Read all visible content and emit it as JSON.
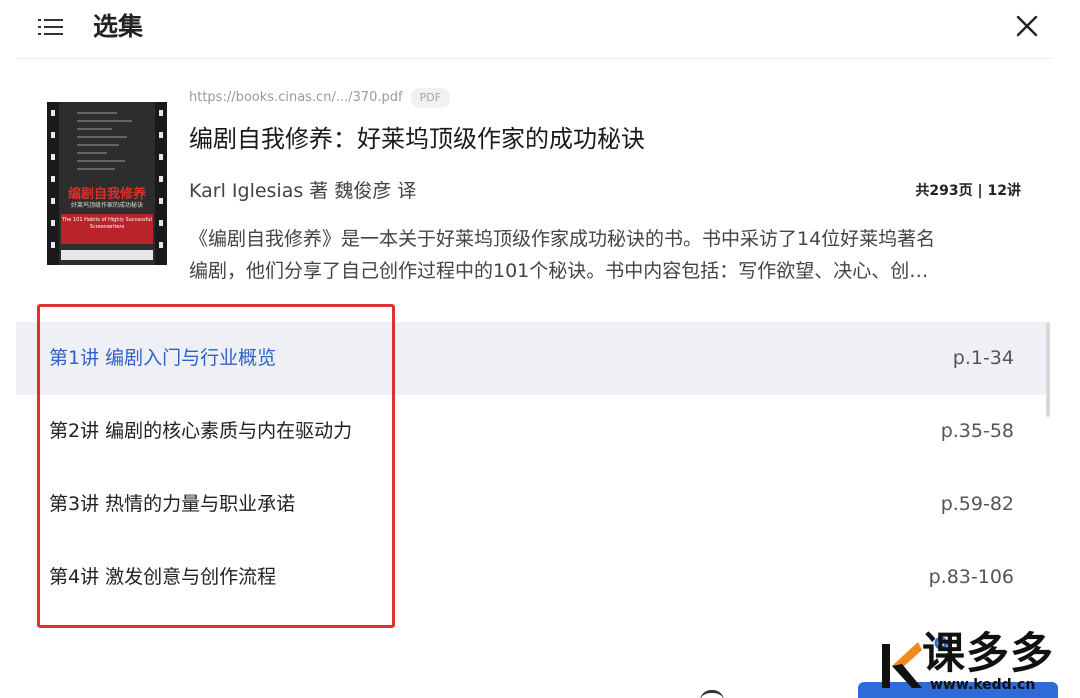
{
  "header": {
    "title": "选集",
    "menu_icon": "menu-icon",
    "close_icon": "close-icon"
  },
  "book": {
    "source_url": "https://books.cinas.cn/.../370.pdf",
    "source_type": "PDF",
    "title": "编剧自我修养：好莱坞顶级作家的成功秘诀",
    "authors": "Karl Iglesias 著 魏俊彦 译",
    "meta": "共293页 | 12讲",
    "description_line1": "《编剧自我修养》是一本关于好莱坞顶级作家成功秘诀的书。书中采访了14位好莱坞著名",
    "description_line2": "编剧，他们分享了自己创作过程中的101个秘诀。书中内容包括：写作欲望、决心、创…",
    "cover": {
      "title": "编剧自我修养",
      "subtitle": "好莱坞顶级作家的成功秘诀",
      "en_title": "The 101 Habits of Highly Successful Screenwriters"
    }
  },
  "chapters": [
    {
      "title": "第1讲 编剧入门与行业概览",
      "pages": "p.1-34",
      "active": true
    },
    {
      "title": "第2讲 编剧的核心素质与内在驱动力",
      "pages": "p.35-58",
      "active": false
    },
    {
      "title": "第3讲 热情的力量与职业承诺",
      "pages": "p.59-82",
      "active": false
    },
    {
      "title": "第4讲 激发创意与创作流程",
      "pages": "p.83-106",
      "active": false
    }
  ],
  "colors": {
    "accent": "#2d63c8",
    "highlight_border": "#e0312e",
    "active_row_bg": "#eef0f5"
  },
  "watermark": {
    "text": "课多多",
    "url": "www.kedd.cn"
  }
}
